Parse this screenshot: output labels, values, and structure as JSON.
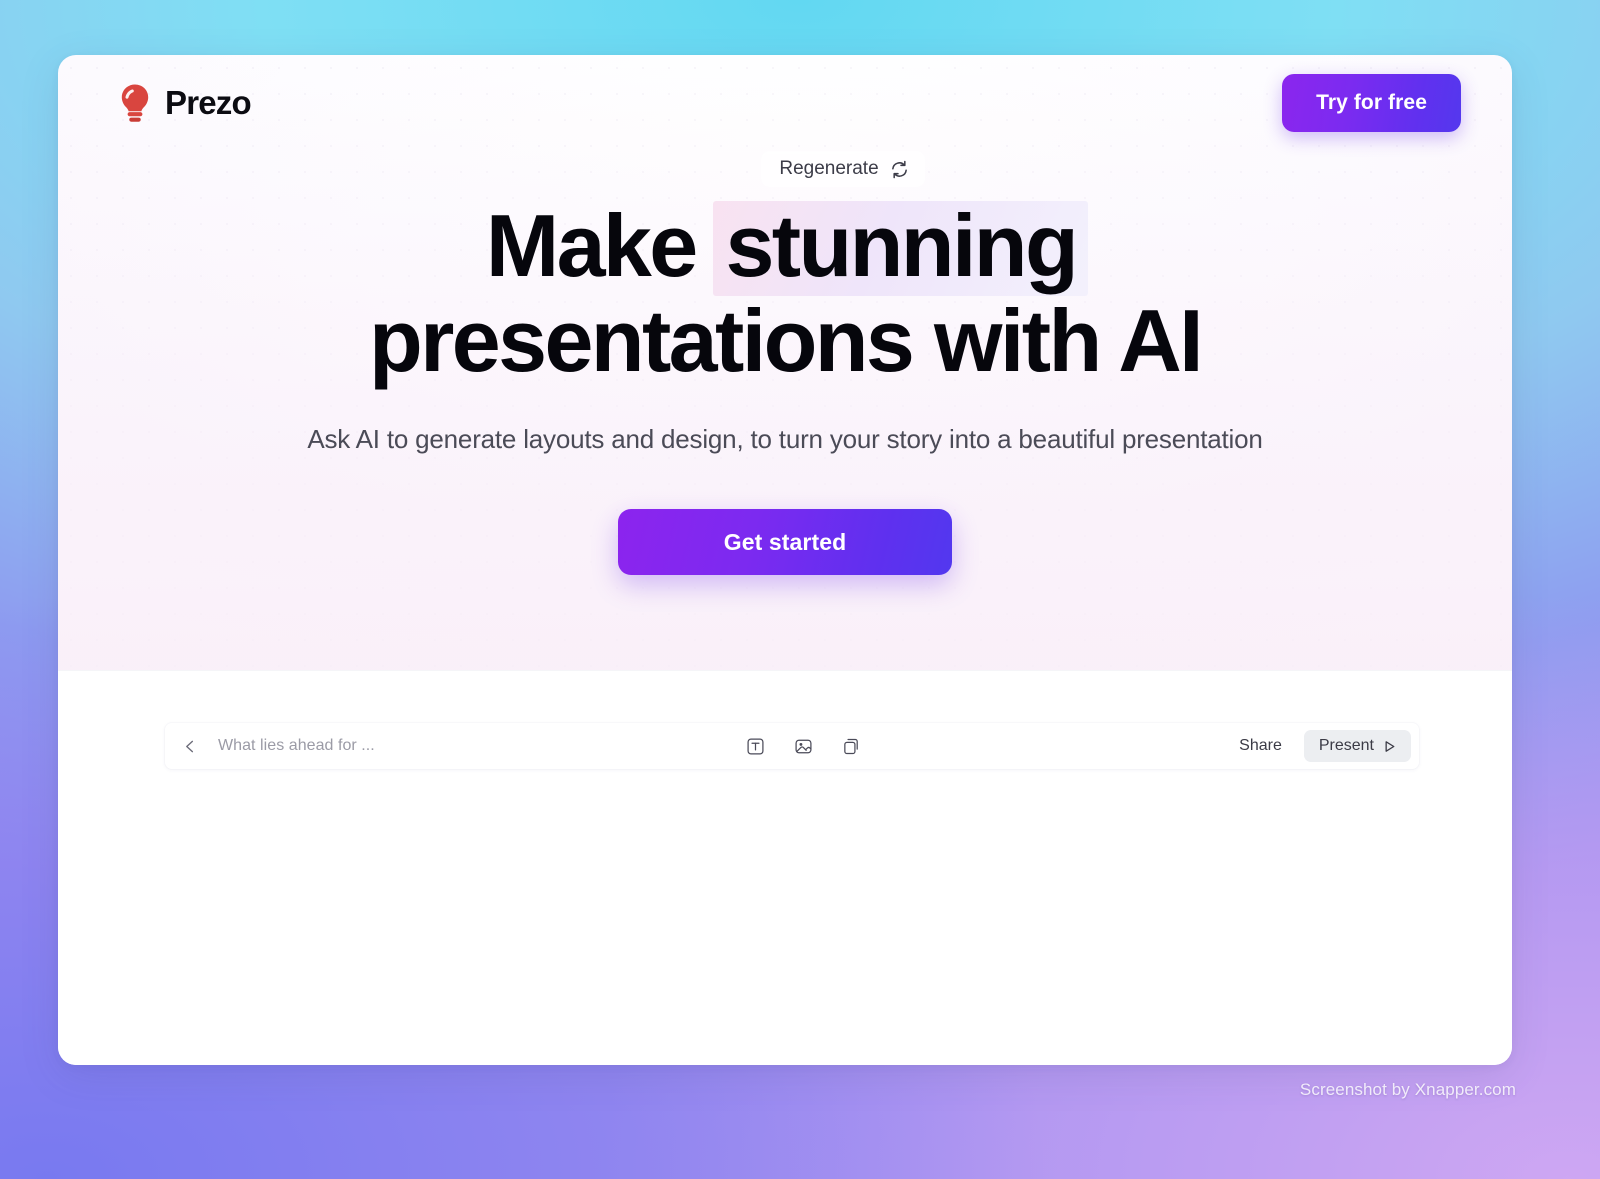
{
  "brand": {
    "name": "Prezo",
    "logo_icon": "lightbulb-icon",
    "logo_color": "#d9453f"
  },
  "topbar": {
    "try_free_label": "Try for free",
    "try_free_gradient_from": "#8b26ee",
    "try_free_gradient_to": "#5438ee"
  },
  "hero": {
    "regenerate_label": "Regenerate",
    "regenerate_icon": "refresh-icon",
    "headline_part1": "Make",
    "headline_highlight": "stunning",
    "headline_part2": "presentations with AI",
    "subheadline": "Ask AI to generate layouts and design, to turn your story into a beautiful presentation",
    "cta_label": "Get started",
    "cta_gradient_from": "#8c24ee",
    "cta_gradient_to": "#5238ef"
  },
  "editor": {
    "back_icon": "chevron-left-icon",
    "deck_title": "What lies ahead for ...",
    "tools": [
      {
        "name": "text-tool",
        "icon": "text-box-icon"
      },
      {
        "name": "image-tool",
        "icon": "image-icon"
      },
      {
        "name": "shape-tool",
        "icon": "shape-icon"
      }
    ],
    "share_label": "Share",
    "present_label": "Present",
    "present_icon": "play-triangle-icon"
  },
  "watermark": {
    "text": "Screenshot by Xnapper.com"
  },
  "background": {
    "top_color": "#62d8f2",
    "bottom_left_color": "#7678f0",
    "bottom_right_color": "#d0a8f3"
  }
}
